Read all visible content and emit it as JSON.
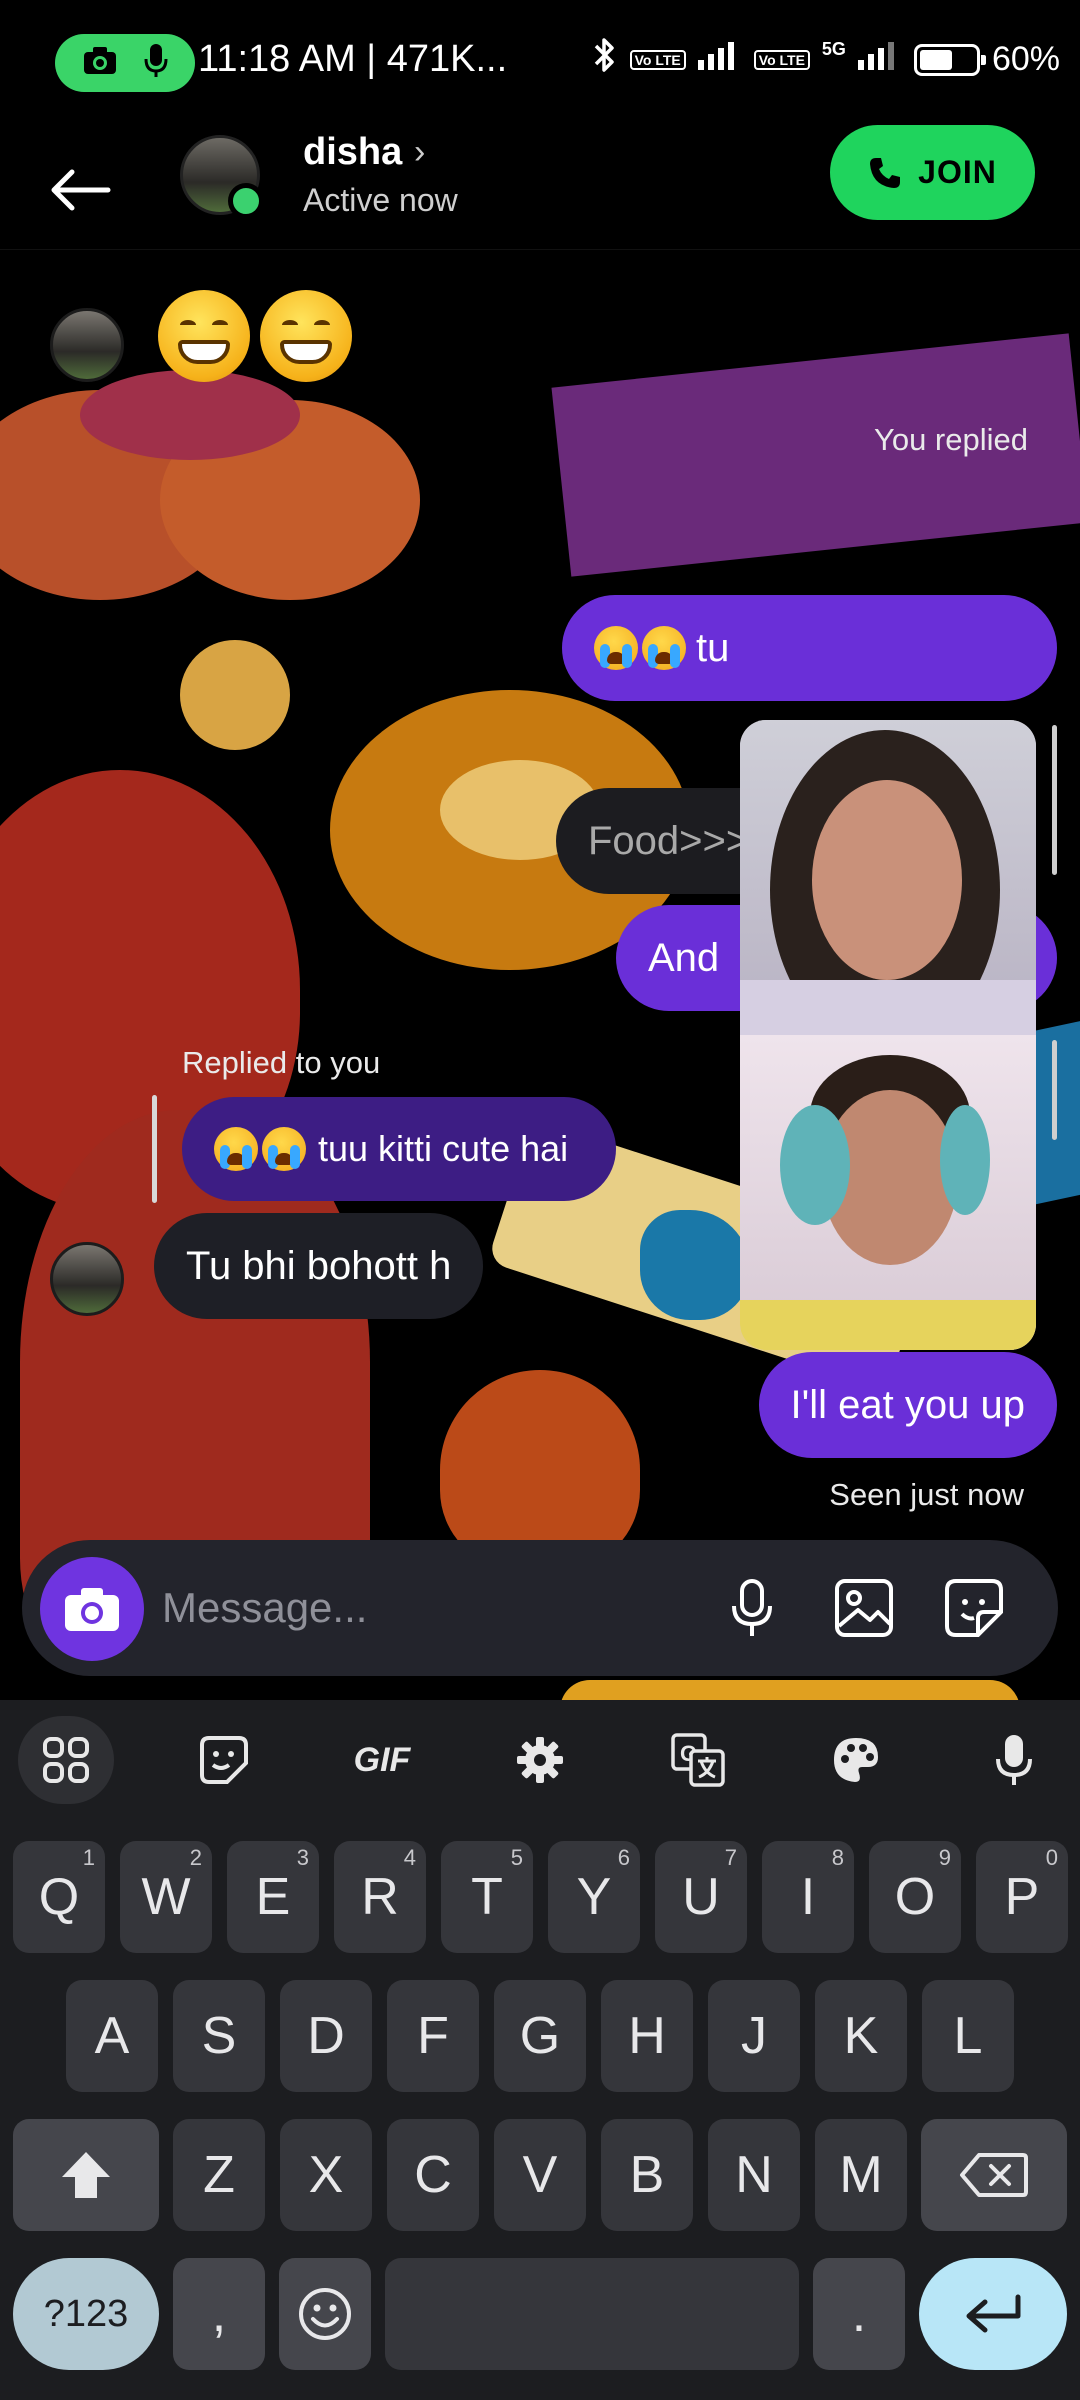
{
  "status_bar": {
    "time": "11:18 AM | 471K...",
    "network_badge_1": "Vo LTE",
    "network_badge_2": "Vo LTE",
    "network_5g": "5G",
    "battery": "60%",
    "battery_level": 0.6,
    "icons": [
      "camera-icon",
      "mic-icon",
      "bluetooth-icon",
      "signal-icon",
      "battery-icon"
    ]
  },
  "header": {
    "contact_name": "disha",
    "chevron": "›",
    "status": "Active now",
    "join_label": "JOIN",
    "icons": [
      "back-arrow-icon",
      "phone-icon"
    ]
  },
  "messages": [
    {
      "type": "received",
      "content": "😁😁"
    },
    {
      "type": "meta",
      "text": "You replied"
    },
    {
      "type": "sent",
      "text": "😭😭 tu"
    },
    {
      "type": "received-reply",
      "text": "Food>>>>"
    },
    {
      "type": "sent",
      "text": "And"
    },
    {
      "type": "meta",
      "text": "Replied to you"
    },
    {
      "type": "reply-quote",
      "text": "tuu kitti cute hai"
    },
    {
      "type": "received",
      "text": "Tu bhi bohott h"
    },
    {
      "type": "sent",
      "text": "I'll eat you up"
    },
    {
      "type": "meta",
      "text": "Seen just now"
    }
  ],
  "composer": {
    "placeholder": "Message...",
    "icons": [
      "camera-icon",
      "mic-icon",
      "image-icon",
      "sticker-icon"
    ]
  },
  "keyboard": {
    "toolbar": [
      "grid-icon",
      "sticker-icon",
      "GIF",
      "settings-icon",
      "translate-icon",
      "palette-icon",
      "mic-icon"
    ],
    "gif_label": "GIF",
    "row1": [
      {
        "k": "Q",
        "h": "1"
      },
      {
        "k": "W",
        "h": "2"
      },
      {
        "k": "E",
        "h": "3"
      },
      {
        "k": "R",
        "h": "4"
      },
      {
        "k": "T",
        "h": "5"
      },
      {
        "k": "Y",
        "h": "6"
      },
      {
        "k": "U",
        "h": "7"
      },
      {
        "k": "I",
        "h": "8"
      },
      {
        "k": "O",
        "h": "9"
      },
      {
        "k": "P",
        "h": "0"
      }
    ],
    "row2": [
      "A",
      "S",
      "D",
      "F",
      "G",
      "H",
      "J",
      "K",
      "L"
    ],
    "row3": [
      "Z",
      "X",
      "C",
      "V",
      "B",
      "N",
      "M"
    ],
    "sym_label": "?123",
    "comma": ",",
    "period": ".",
    "colors": {
      "enter": "#b8e6f7",
      "sym": "#b2c9d3"
    }
  },
  "colors": {
    "sent_bubble": "#6a2fd8",
    "join_green": "#1fd45d",
    "online_dot": "#3bd16f"
  }
}
